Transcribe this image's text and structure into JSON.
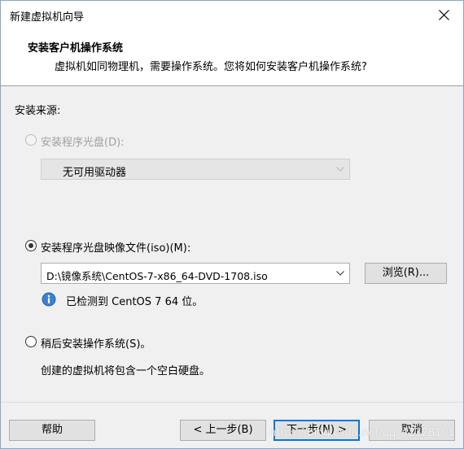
{
  "window": {
    "title": "新建虚拟机向导"
  },
  "header": {
    "title": "安装客户机操作系统",
    "subtitle": "虚拟机如同物理机，需要操作系统。您将如何安装客户机操作系统?"
  },
  "source_label": "安装来源:",
  "options": {
    "disc": {
      "label": "安装程序光盘(D):",
      "selected": false,
      "enabled": false,
      "drive_value": "无可用驱动器"
    },
    "iso": {
      "label": "安装程序光盘映像文件(iso)(M):",
      "selected": true,
      "enabled": true,
      "path_value": "D:\\镜像系统\\CentOS-7-x86_64-DVD-1708.iso",
      "browse_label": "浏览(R)...",
      "detected_text": "已检测到 CentOS 7 64 位。"
    },
    "later": {
      "label": "稍后安装操作系统(S)。",
      "selected": false,
      "enabled": true,
      "description": "创建的虚拟机将包含一个空白硬盘。"
    }
  },
  "footer": {
    "help_label": "帮助",
    "back_label": "< 上一步(B)",
    "next_label": "下一步(N) >",
    "cancel_label": "取消"
  },
  "watermark": "https://blog.csdn.net/qq_42328101",
  "colors": {
    "accent": "#0078d7",
    "info_icon": "#3a7fd5",
    "disabled_text": "#a0a0a0"
  }
}
